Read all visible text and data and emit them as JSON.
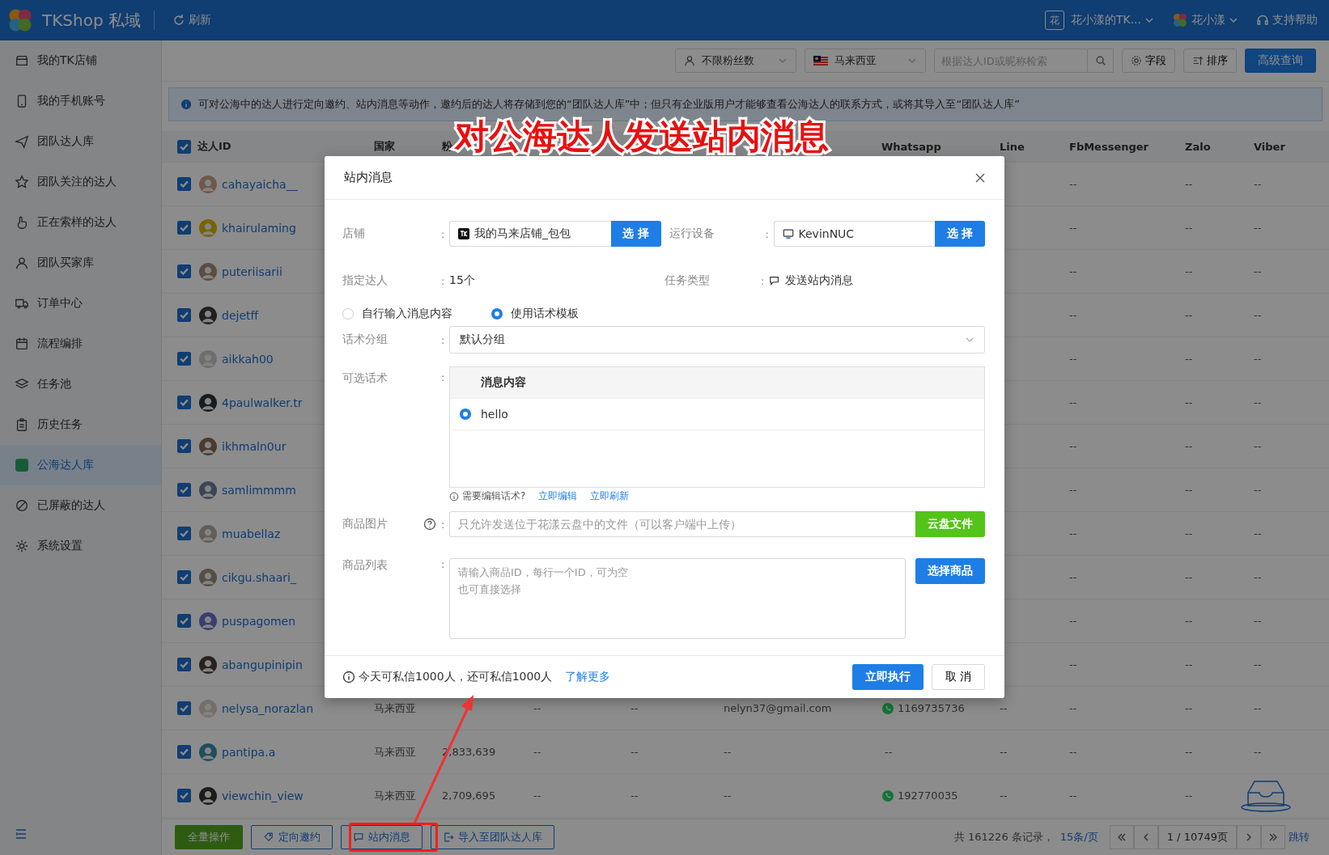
{
  "topbar": {
    "brand": "TKShop 私域",
    "refresh": "刷新",
    "account_badge": "花",
    "account": "花小漾的TK...",
    "user": "花小漾",
    "help": "支持帮助"
  },
  "sidebar": {
    "items": [
      {
        "label": "我的TK店铺",
        "selected": false
      },
      {
        "label": "我的手机账号",
        "selected": false
      },
      {
        "label": "团队达人库",
        "selected": false
      },
      {
        "label": "团队关注的达人",
        "selected": false
      },
      {
        "label": "正在索样的达人",
        "selected": false
      },
      {
        "label": "团队买家库",
        "selected": false
      },
      {
        "label": "订单中心",
        "selected": false
      },
      {
        "label": "流程编排",
        "selected": false
      },
      {
        "label": "任务池",
        "selected": false
      },
      {
        "label": "历史任务",
        "selected": false
      },
      {
        "label": "公海达人库",
        "selected": true
      },
      {
        "label": "已屏蔽的达人",
        "selected": false
      },
      {
        "label": "系统设置",
        "selected": false
      }
    ]
  },
  "toolbar": {
    "fans_filter": "不限粉丝数",
    "country_filter": "马来西亚",
    "search": {
      "placeholder": "根据达人ID或昵称检索"
    },
    "fields": "字段",
    "sort": "排序",
    "advanced": "高级查询"
  },
  "notice": "可对公海中的达人进行定向邀约、站内消息等动作，邀约后的达人将存储到您的“团队达人库”中；但只有企业版用户才能够查看公海达人的联系方式，或将其导入至“团队达人库”",
  "table": {
    "all_checked": true,
    "columns": {
      "creator_id": "达人ID",
      "country": "国家",
      "followers": "粉",
      "whatsapp": "Whatsapp",
      "line": "Line",
      "fbmessenger": "FbMessenger",
      "zalo": "Zalo",
      "viber": "Viber"
    },
    "rows": [
      {
        "id": "cahayaicha__",
        "checked": true,
        "fbmessenger": "--",
        "zalo": "--",
        "viber": "--"
      },
      {
        "id": "khairulaming",
        "checked": true,
        "fbmessenger": "--",
        "zalo": "--",
        "viber": "--"
      },
      {
        "id": "puteriisarii",
        "checked": true,
        "fbmessenger": "--",
        "zalo": "--",
        "viber": "--"
      },
      {
        "id": "dejetff",
        "checked": true,
        "fbmessenger": "--",
        "zalo": "--",
        "viber": "--"
      },
      {
        "id": "aikkah00",
        "checked": true,
        "fbmessenger": "--",
        "zalo": "--",
        "viber": "--"
      },
      {
        "id": "4paulwalker.tr",
        "checked": true,
        "fbmessenger": "--",
        "zalo": "--",
        "viber": "--"
      },
      {
        "id": "ikhmaln0ur",
        "checked": true,
        "fbmessenger": "--",
        "zalo": "--",
        "viber": "--"
      },
      {
        "id": "samlimmmm",
        "checked": true,
        "fbmessenger": "--",
        "zalo": "--",
        "viber": "--"
      },
      {
        "id": "muabellaz",
        "checked": true,
        "fbmessenger": "--",
        "zalo": "--",
        "viber": "--"
      },
      {
        "id": "cikgu.shaari_",
        "checked": true,
        "fbmessenger": "--",
        "zalo": "--",
        "viber": "--"
      },
      {
        "id": "puspagomen",
        "checked": true,
        "fbmessenger": "--",
        "zalo": "--",
        "viber": "--"
      },
      {
        "id": "abangupinipin",
        "checked": true,
        "fbmessenger": "--",
        "zalo": "--",
        "viber": "--"
      },
      {
        "id": "nelysa_norazlan",
        "checked": true,
        "country": "马来西亚",
        "column_4": "--",
        "column_5": "--",
        "column_6": "nelyn37@gmail.com",
        "whatsapp": "1169735736",
        "whatsapp_linked": true,
        "line": "--",
        "fbmessenger": "--",
        "zalo": "--",
        "viber": "--"
      },
      {
        "id": "pantipa.a",
        "checked": true,
        "country": "马来西亚",
        "followers": "2,833,639",
        "column_4": "--",
        "column_5": "--",
        "column_6": "--",
        "whatsapp": "--",
        "whatsapp_linked": false,
        "line": "--",
        "fbmessenger": "--",
        "zalo": "--",
        "viber": "--"
      },
      {
        "id": "viewchin_view",
        "checked": true,
        "country": "马来西亚",
        "followers": "2,709,695",
        "column_4": "--",
        "column_5": "--",
        "column_6": "--",
        "whatsapp": "192770035",
        "whatsapp_linked": true,
        "line": "--",
        "fbmessenger": "--",
        "zalo": "--"
      }
    ]
  },
  "dialog": {
    "title": "站内消息",
    "shop": {
      "label": "店铺",
      "colon": ":",
      "value": "我的马来店铺_包包",
      "button": "选 择"
    },
    "device": {
      "label": "运行设备",
      "colon": ":",
      "value": "KevinNUC",
      "button": "选 择"
    },
    "creators": {
      "label": "指定达人",
      "colon": ":",
      "value": "15个"
    },
    "task_type": {
      "label": "任务类型",
      "colon": ":",
      "value": "发送站内消息"
    },
    "modes": [
      {
        "label": "自行输入消息内容",
        "selected": false
      },
      {
        "label": "使用话术模板",
        "selected": true
      }
    ],
    "group": {
      "label": "话术分组",
      "colon": ":",
      "value": "默认分组"
    },
    "scripts": {
      "label": "可选话术",
      "colon": ":",
      "column": "消息内容",
      "rows": [
        {
          "text": "hello",
          "selected": true
        }
      ],
      "hint": "需要编辑话术?",
      "edit_link": "立即编辑",
      "refresh_link": "立即刷新"
    },
    "image": {
      "label": "商品图片",
      "colon": ":",
      "placeholder": "只允许发送位于花漾云盘中的文件（可以客户端中上传）",
      "button": "云盘文件"
    },
    "products": {
      "label": "商品列表",
      "colon": ":",
      "placeholder_lines": [
        "请输入商品ID，每行一个ID，可为空",
        "也可直接选择"
      ],
      "button": "选择商品"
    },
    "quota": "今天可私信1000人，还可私信1000人",
    "learn_more": "了解更多",
    "submit": "立即执行",
    "cancel": "取 消"
  },
  "footer": {
    "actions": [
      {
        "label": "全量操作",
        "kind": "bulk",
        "highlighted": false
      },
      {
        "label": "定向邀约",
        "kind": "invite",
        "highlighted": false
      },
      {
        "label": "站内消息",
        "kind": "message",
        "highlighted": true
      },
      {
        "label": "导入至团队达人库",
        "kind": "import",
        "highlighted": false
      }
    ],
    "total": "共 161226 条记录，",
    "page_size": "15条/页",
    "page": "1 / 10749页",
    "jump": "跳转"
  },
  "annotation": {
    "caption": "对公海达人发送站内消息"
  }
}
